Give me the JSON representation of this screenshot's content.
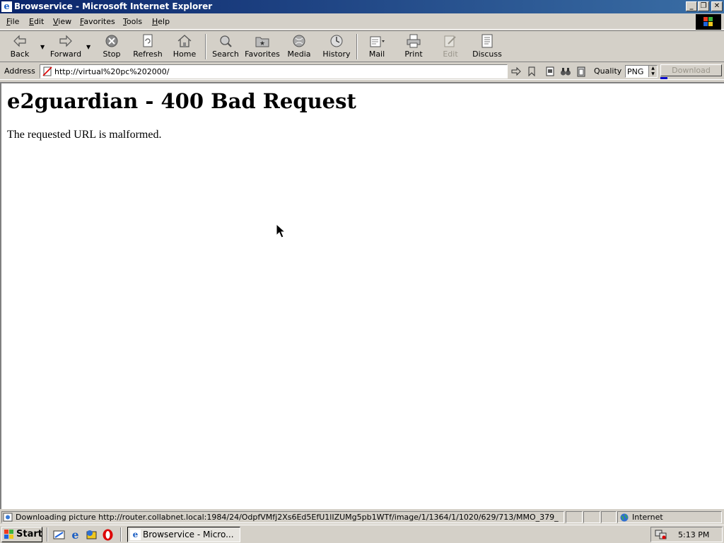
{
  "window": {
    "title": "Browservice - Microsoft Internet Explorer",
    "controls": {
      "minimize": "_",
      "maximize": "❐",
      "close": "✕"
    }
  },
  "menu": [
    "File",
    "Edit",
    "View",
    "Favorites",
    "Tools",
    "Help"
  ],
  "toolbar": {
    "back": "Back",
    "forward": "Forward",
    "stop": "Stop",
    "refresh": "Refresh",
    "home": "Home",
    "search": "Search",
    "favorites": "Favorites",
    "media": "Media",
    "history": "History",
    "mail": "Mail",
    "print": "Print",
    "edit": "Edit",
    "discuss": "Discuss"
  },
  "address": {
    "label": "Address",
    "url": "http://virtual%20pc%202000/"
  },
  "quality": {
    "label": "Quality",
    "value": "PNG"
  },
  "download": {
    "label": "Download",
    "progress": 0.12
  },
  "page": {
    "heading": "e2guardian - 400 Bad Request",
    "message": "The requested URL is malformed."
  },
  "status": {
    "text": "Downloading picture http://router.collabnet.local:1984/24/OdpfVMfj2Xs6Ed5EfU1lIZUMg5pb1WTf/image/1/1364/1/1020/629/713/MMO_379_",
    "zone": "Internet"
  },
  "taskbar": {
    "start": "Start",
    "task": "Browservice - Micro...",
    "clock": "5:13 PM"
  },
  "colors": {
    "titlebar_start": "#0a246a",
    "titlebar_end": "#3a6ea5",
    "chrome": "#d4d0c8",
    "progress": "#0000c8"
  }
}
